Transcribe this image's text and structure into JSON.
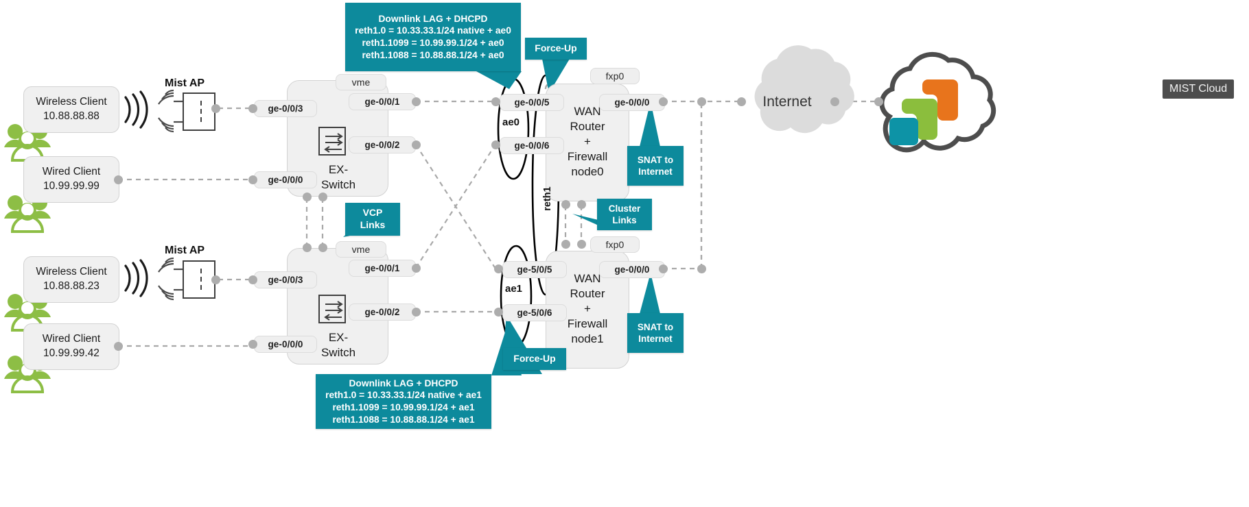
{
  "diagram": {
    "title": "Juniper EX-Switch / SRX Cluster WAN topology",
    "accent_color": "#0d8a9c",
    "node_fill": "#f0f0f0",
    "link_color": "#a8a8a8"
  },
  "clients": [
    {
      "name": "Wireless Client",
      "ip": "10.88.88.88",
      "port": "ge-0/0/3",
      "kind": "wireless"
    },
    {
      "name": "Wired Client",
      "ip": "10.99.99.99",
      "port": "ge-0/0/0",
      "kind": "wired"
    },
    {
      "name": "Wireless Client",
      "ip": "10.88.88.23",
      "port": "ge-0/0/3",
      "kind": "wireless"
    },
    {
      "name": "Wired Client",
      "ip": "10.99.99.42",
      "port": "ge-0/0/0",
      "kind": "wired"
    }
  ],
  "access_points": [
    {
      "label": "Mist AP"
    },
    {
      "label": "Mist AP"
    }
  ],
  "switches": [
    {
      "name": "EX-\nSwitch",
      "name_line1": "EX-",
      "name_line2": "Switch",
      "mgmt_port": "vme",
      "uplink_ports": [
        "ge-0/0/1",
        "ge-0/0/2"
      ],
      "access_ports": [
        "ge-0/0/3",
        "ge-0/0/0"
      ]
    },
    {
      "name": "EX-\nSwitch",
      "name_line1": "EX-",
      "name_line2": "Switch",
      "mgmt_port": "vme",
      "uplink_ports": [
        "ge-0/0/1",
        "ge-0/0/2"
      ],
      "access_ports": [
        "ge-0/0/3",
        "ge-0/0/0"
      ]
    }
  ],
  "routers": [
    {
      "title_line1": "WAN",
      "title_line2": "Router",
      "title_line3": "+",
      "title_line4": "Firewall",
      "title_line5": "node0",
      "mgmt_port": "fxp0",
      "wan_port": "ge-0/0/0",
      "lag_ports": [
        "ge-0/0/5",
        "ge-0/0/6"
      ],
      "lag_name": "ae0",
      "reth_name": "reth1"
    },
    {
      "title_line1": "WAN",
      "title_line2": "Router",
      "title_line3": "+",
      "title_line4": "Firewall",
      "title_line5": "node1",
      "mgmt_port": "fxp0",
      "wan_port": "ge-0/0/0",
      "lag_ports": [
        "ge-5/0/5",
        "ge-5/0/6"
      ],
      "lag_name": "ae1",
      "reth_name": "reth1"
    }
  ],
  "callouts": {
    "downlink_top": {
      "heading": "Downlink LAG + DHCPD",
      "line1": "reth1.0 = 10.33.33.1/24 native + ae0",
      "line2": "reth1.1099 = 10.99.99.1/24 + ae0",
      "line3": "reth1.1088 = 10.88.88.1/24 + ae0"
    },
    "downlink_bottom": {
      "heading": "Downlink LAG + DHCPD",
      "line1": "reth1.0 = 10.33.33.1/24 native + ae1",
      "line2": "reth1.1099 = 10.99.99.1/24 + ae1",
      "line3": "reth1.1088 = 10.88.88.1/24 + ae1"
    },
    "force_up_top": "Force-Up",
    "force_up_bottom": "Force-Up",
    "vcp_links": {
      "line1": "VCP",
      "line2": "Links"
    },
    "cluster_links": {
      "line1": "Cluster",
      "line2": "Links"
    },
    "snat_top": {
      "line1": "SNAT to",
      "line2": "Internet"
    },
    "snat_bottom": {
      "line1": "SNAT to",
      "line2": "Internet"
    }
  },
  "internet": {
    "label": "Internet"
  },
  "mist_cloud": {
    "badge": "MIST Cloud",
    "logo_colors": {
      "orange": "#e8741c",
      "green": "#8bbe3d",
      "teal": "#0d93a6"
    },
    "cloud_outline": "#4d4d4d"
  }
}
